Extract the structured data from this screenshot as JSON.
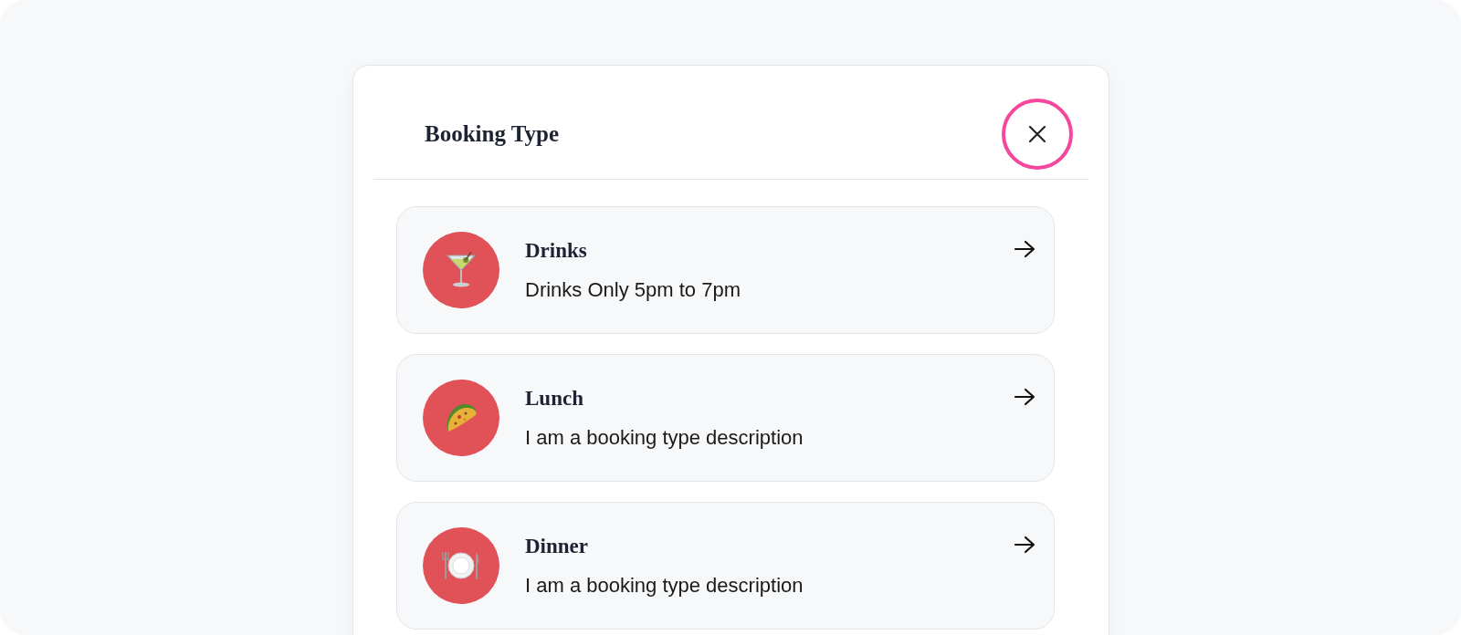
{
  "dialog": {
    "title": "Booking Type"
  },
  "booking_types": [
    {
      "kind": "drink",
      "title": "Drinks",
      "description": "Drinks Only 5pm to 7pm"
    },
    {
      "kind": "taco",
      "title": "Lunch",
      "description": "I am a booking type description"
    },
    {
      "kind": "plate",
      "title": "Dinner",
      "description": "I am a booking type description"
    }
  ]
}
